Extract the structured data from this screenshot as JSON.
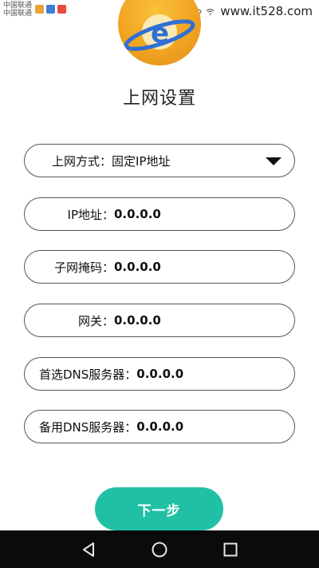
{
  "status_bar": {
    "carrier_line1": "中国联通",
    "carrier_line2": "中国联通",
    "watermark": "www.it528.com"
  },
  "colors": {
    "accent": "#20c0a4",
    "logo_orange": "#f2a421",
    "logo_blue": "#2f6fd6"
  },
  "page": {
    "title": "上网设置"
  },
  "fields": {
    "mode": {
      "label": "上网方式：",
      "value": "固定IP地址"
    },
    "ip": {
      "label": "IP地址：",
      "value": "0.0.0.0"
    },
    "subnet": {
      "label": "子网掩码：",
      "value": "0.0.0.0"
    },
    "gateway": {
      "label": "网关：",
      "value": "0.0.0.0"
    },
    "dns_primary": {
      "label": "首选DNS服务器：",
      "value": "0.0.0.0"
    },
    "dns_secondary": {
      "label": "备用DNS服务器：",
      "value": "0.0.0.0"
    }
  },
  "buttons": {
    "next": "下一步"
  },
  "icons": {
    "logo": "planet-e-icon",
    "dropdown": "triangle-down-icon",
    "nav_back": "back-triangle-icon",
    "nav_home": "home-circle-icon",
    "nav_recent": "recent-square-icon"
  }
}
